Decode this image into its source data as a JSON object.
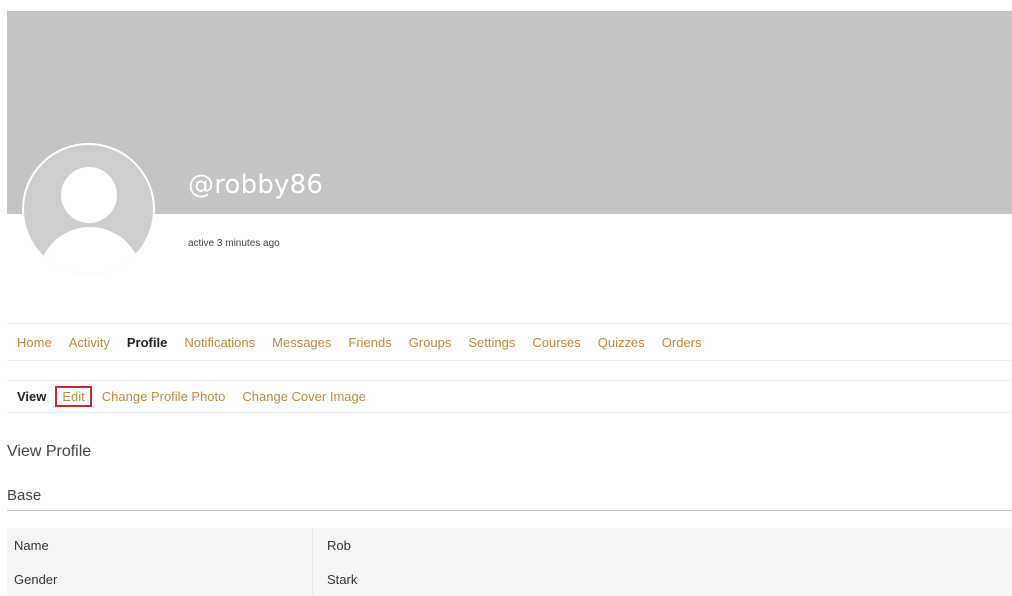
{
  "profile": {
    "username": "@robby86",
    "last_active": "active 3 minutes ago"
  },
  "nav_primary": {
    "items": [
      {
        "label": "Home"
      },
      {
        "label": "Activity"
      },
      {
        "label": "Profile"
      },
      {
        "label": "Notifications"
      },
      {
        "label": "Messages"
      },
      {
        "label": "Friends"
      },
      {
        "label": "Groups"
      },
      {
        "label": "Settings"
      },
      {
        "label": "Courses"
      },
      {
        "label": "Quizzes"
      },
      {
        "label": "Orders"
      }
    ],
    "current": "Profile"
  },
  "nav_secondary": {
    "items": [
      {
        "label": "View"
      },
      {
        "label": "Edit"
      },
      {
        "label": "Change Profile Photo"
      },
      {
        "label": "Change Cover Image"
      }
    ],
    "current": "View",
    "highlighted": "Edit"
  },
  "page": {
    "title": "View Profile",
    "group_title": "Base"
  },
  "fields": [
    {
      "name": "Name",
      "value": "Rob"
    },
    {
      "name": "Gender",
      "value": "Stark"
    }
  ],
  "colors": {
    "cover": "#c4c4c4",
    "link": "#c28a43",
    "highlight_border": "#d0262d"
  }
}
